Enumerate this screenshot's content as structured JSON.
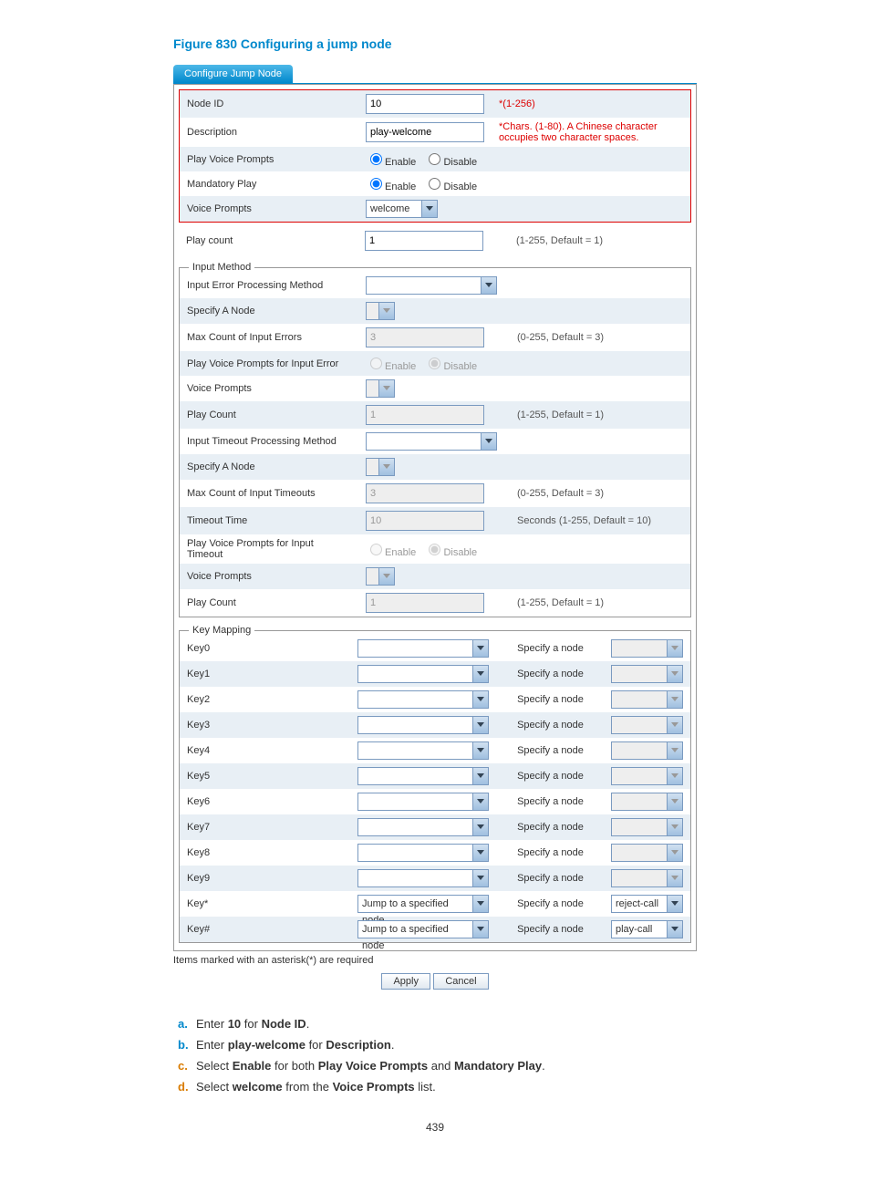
{
  "figure_title": "Figure 830 Configuring a jump node",
  "tab": "Configure Jump Node",
  "box": {
    "node_id": {
      "label": "Node ID",
      "value": "10",
      "hint": "*(1-256)"
    },
    "description": {
      "label": "Description",
      "value": "play-welcome",
      "hint": "*Chars. (1-80). A Chinese character occupies two character spaces."
    },
    "play_voice": {
      "label": "Play Voice Prompts",
      "enable": "Enable",
      "disable": "Disable"
    },
    "mandatory": {
      "label": "Mandatory Play",
      "enable": "Enable",
      "disable": "Disable"
    },
    "voice_prompts": {
      "label": "Voice Prompts",
      "value": "welcome"
    }
  },
  "play_count": {
    "label": "Play count",
    "value": "1",
    "hint": "(1-255, Default = 1)"
  },
  "input": {
    "legend": "Input Method",
    "error_method": {
      "label": "Input Error Processing Method"
    },
    "specify_a": {
      "label": "Specify A Node"
    },
    "max_errors": {
      "label": "Max Count of Input Errors",
      "value": "3",
      "hint": "(0-255, Default = 3)"
    },
    "play_err": {
      "label": "Play Voice Prompts for Input Error",
      "enable": "Enable",
      "disable": "Disable"
    },
    "vp": {
      "label": "Voice Prompts"
    },
    "pc": {
      "label": "Play Count",
      "value": "1",
      "hint": "(1-255, Default = 1)"
    },
    "timeout_method": {
      "label": "Input Timeout Processing Method"
    },
    "specify_b": {
      "label": "Specify A Node"
    },
    "max_timeouts": {
      "label": "Max Count of Input Timeouts",
      "value": "3",
      "hint": "(0-255, Default = 3)"
    },
    "timeout_time": {
      "label": "Timeout Time",
      "value": "10",
      "hint": "Seconds (1-255, Default = 10)"
    },
    "play_to": {
      "label": "Play Voice Prompts for Input Timeout",
      "enable": "Enable",
      "disable": "Disable"
    },
    "vp2": {
      "label": "Voice Prompts"
    },
    "pc2": {
      "label": "Play Count",
      "value": "1",
      "hint": "(1-255, Default = 1)"
    }
  },
  "keymap": {
    "legend": "Key Mapping",
    "spec": "Specify a node",
    "keys": [
      "Key0",
      "Key1",
      "Key2",
      "Key3",
      "Key4",
      "Key5",
      "Key6",
      "Key7",
      "Key8",
      "Key9",
      "Key*",
      "Key#"
    ],
    "jump": "Jump to a specified node",
    "star_node": "reject-call",
    "hash_node": "play-call"
  },
  "footer": "Items marked with an asterisk(*) are required",
  "apply": "Apply",
  "cancel": "Cancel",
  "instr": {
    "a": "Enter 10 for Node ID.",
    "b": "Enter play-welcome for Description.",
    "c": "Select Enable for both Play Voice Prompts and Mandatory Play.",
    "d": "Select welcome from the Voice Prompts list."
  },
  "page": "439"
}
